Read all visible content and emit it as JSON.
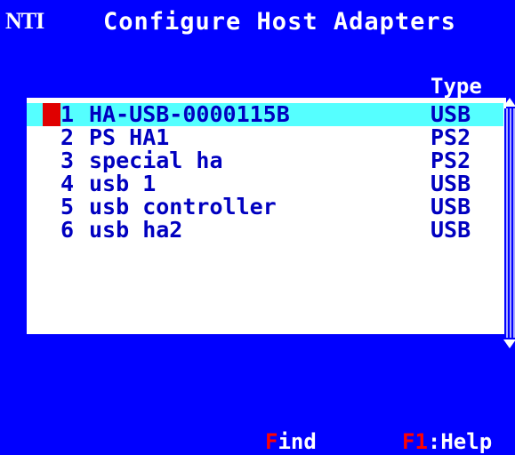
{
  "header": {
    "logo": "NTI",
    "title": "Configure Host Adapters"
  },
  "list": {
    "column_type": "Type",
    "rows": [
      {
        "num": "1",
        "name": "HA-USB-0000115B",
        "type": "USB"
      },
      {
        "num": "2",
        "name": "PS HA1",
        "type": "PS2"
      },
      {
        "num": "3",
        "name": "special ha",
        "type": "PS2"
      },
      {
        "num": "4",
        "name": "usb 1",
        "type": "USB"
      },
      {
        "num": "5",
        "name": "usb controller",
        "type": "USB"
      },
      {
        "num": "6",
        "name": "usb ha2",
        "type": "USB"
      }
    ]
  },
  "footer": {
    "find_hotkey": "F",
    "find_rest": "ind",
    "help_hotkey": "F1",
    "help_rest": ":Help"
  },
  "colors": {
    "background": "#0000ff",
    "selection": "#55ffff",
    "hotkey": "#ff0000",
    "list_text": "#0000c0"
  },
  "icons": {
    "scroll_up": "arrow-up-icon",
    "scroll_down": "arrow-down-icon",
    "selection_marker": "selection-marker-icon"
  }
}
